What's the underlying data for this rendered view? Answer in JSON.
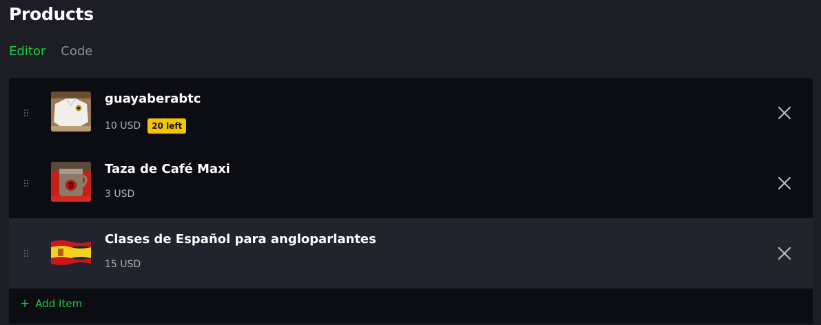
{
  "page": {
    "title": "Products"
  },
  "tabs": [
    {
      "label": "Editor",
      "active": true
    },
    {
      "label": "Code",
      "active": false
    }
  ],
  "products": [
    {
      "name": "guayaberabtc",
      "price": "10 USD",
      "badge": "20 left",
      "thumb_icon": "shirt-photo-icon"
    },
    {
      "name": "Taza de Café Maxi",
      "price": "3 USD",
      "badge": "",
      "thumb_icon": "coffee-mug-photo-icon"
    },
    {
      "name": "Clases de Español para angloparlantes",
      "price": "15 USD",
      "badge": "",
      "thumb_icon": "spain-flag-icon"
    }
  ],
  "add_item": {
    "label": "Add Item",
    "icon": "plus-icon"
  },
  "colors": {
    "accent": "#1fcc3a",
    "badge": "#f5c400",
    "background": "#1d1e25",
    "list_background": "#0c0d13",
    "active_row": "#22242d"
  }
}
